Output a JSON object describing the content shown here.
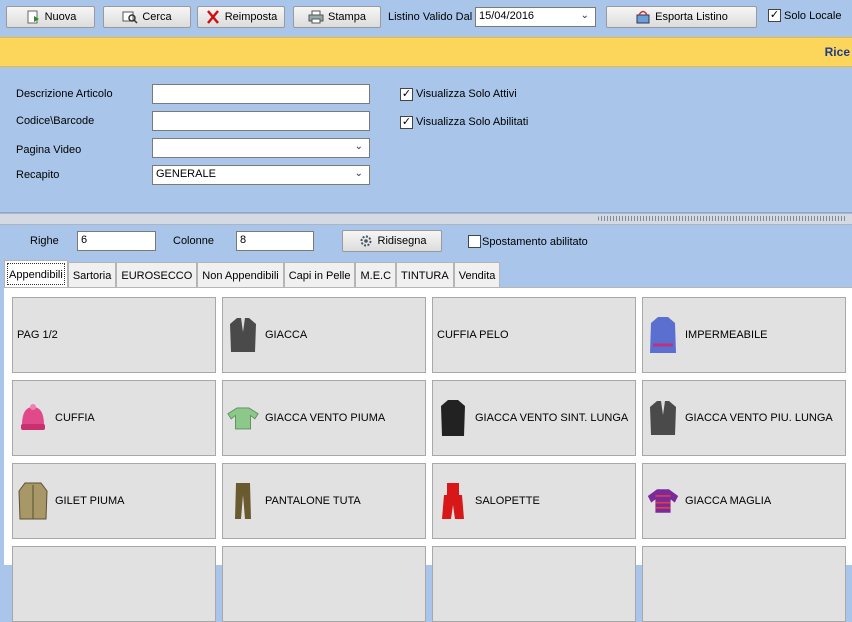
{
  "toolbar": {
    "new_label": "Nuova",
    "search_label": "Cerca",
    "reset_label": "Reimposta",
    "print_label": "Stampa",
    "valid_from_label": "Listino Valido Dal",
    "valid_from_value": "15/04/2016",
    "export_label": "Esporta Listino",
    "local_only_label": "Solo Locale",
    "local_only_checked": true
  },
  "banner": {
    "text": "Rice"
  },
  "filters": {
    "description_label": "Descrizione Articolo",
    "description_value": "",
    "code_label": "Codice\\Barcode",
    "code_value": "",
    "page_label": "Pagina Video",
    "page_value": "",
    "address_label": "Recapito",
    "address_value": "GENERALE",
    "active_only_label": "Visualizza Solo Attivi",
    "active_only_checked": true,
    "enabled_only_label": "Visualizza Solo Abilitati",
    "enabled_only_checked": true
  },
  "grid_settings": {
    "rows_label": "Righe",
    "rows_value": "6",
    "cols_label": "Colonne",
    "cols_value": "8",
    "redraw_label": "Ridisegna",
    "move_enabled_label": "Spostamento abilitato",
    "move_enabled_checked": false
  },
  "tabs": [
    {
      "label": "Appendibili",
      "active": true
    },
    {
      "label": "Sartoria"
    },
    {
      "label": "EUROSECCO"
    },
    {
      "label": "Non Appendibili"
    },
    {
      "label": "Capi in Pelle"
    },
    {
      "label": "M.E.C"
    },
    {
      "label": "TINTURA"
    },
    {
      "label": "Vendita"
    }
  ],
  "tiles": [
    {
      "label": "PAG 1/2",
      "icon": ""
    },
    {
      "label": "GIACCA",
      "icon": "jacket-gray-icon"
    },
    {
      "label": "CUFFIA PELO",
      "icon": ""
    },
    {
      "label": "IMPERMEABILE",
      "icon": "raincoat-icon"
    },
    {
      "label": "CUFFIA",
      "icon": "hat-pink-icon"
    },
    {
      "label": "GIACCA VENTO PIUMA",
      "icon": "down-jacket-green-icon"
    },
    {
      "label": "GIACCA VENTO SINT. LUNGA",
      "icon": "long-coat-black-icon"
    },
    {
      "label": "GIACCA VENTO PIU. LUNGA",
      "icon": "jacket-gray-icon"
    },
    {
      "label": "GILET PIUMA",
      "icon": "vest-icon"
    },
    {
      "label": "PANTALONE TUTA",
      "icon": "trousers-icon"
    },
    {
      "label": "SALOPETTE",
      "icon": "salopette-red-icon"
    },
    {
      "label": "GIACCA MAGLIA",
      "icon": "knit-jacket-icon"
    },
    {
      "label": "",
      "icon": ""
    },
    {
      "label": "",
      "icon": ""
    },
    {
      "label": "",
      "icon": ""
    },
    {
      "label": "",
      "icon": ""
    }
  ],
  "colors": {
    "panel_bg": "#a9c6ea",
    "banner_bg": "#fcd65a",
    "banner_text": "#1f3a8a",
    "tile_bg": "#e1e1e1"
  }
}
